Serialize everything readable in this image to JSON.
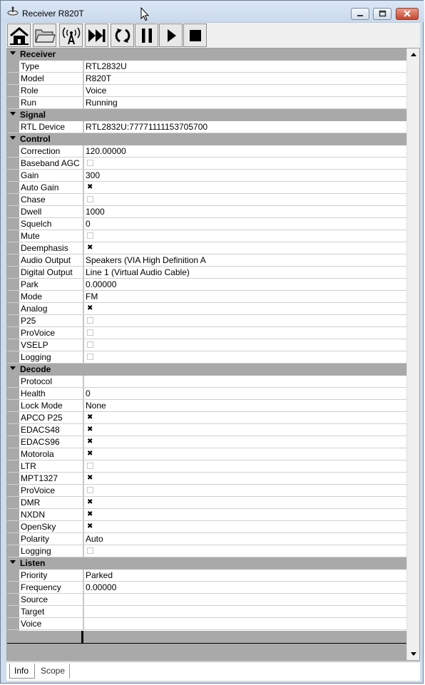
{
  "window": {
    "title": "Receiver R820T"
  },
  "toolbar": {
    "buttons": [
      {
        "name": "home-button",
        "icon": "home-icon"
      },
      {
        "name": "open-button",
        "icon": "folder-icon"
      },
      {
        "name": "antenna-button",
        "icon": "antenna-icon"
      },
      {
        "name": "skip-button",
        "icon": "skip-forward-icon"
      },
      {
        "name": "refresh-button",
        "icon": "refresh-icon"
      },
      {
        "name": "pause-button",
        "icon": "pause-icon"
      },
      {
        "name": "play-button",
        "icon": "play-icon"
      },
      {
        "name": "stop-button",
        "icon": "stop-icon"
      }
    ]
  },
  "grid": {
    "categories": [
      {
        "label": "Receiver",
        "rows": [
          {
            "name": "Type",
            "value": "RTL2832U"
          },
          {
            "name": "Model",
            "value": "R820T"
          },
          {
            "name": "Role",
            "value": "Voice"
          },
          {
            "name": "Run",
            "value": "Running"
          }
        ]
      },
      {
        "label": "Signal",
        "rows": [
          {
            "name": "RTL Device",
            "value": "RTL2832U:77771111153705700"
          }
        ]
      },
      {
        "label": "Control",
        "rows": [
          {
            "name": "Correction",
            "value": "120.00000"
          },
          {
            "name": "Baseband AGC",
            "checkbox": true,
            "checked": false
          },
          {
            "name": "Gain",
            "value": "300"
          },
          {
            "name": "Auto Gain",
            "checkbox": true,
            "checked": true
          },
          {
            "name": "Chase",
            "checkbox": true,
            "checked": false
          },
          {
            "name": "Dwell",
            "value": "1000"
          },
          {
            "name": "Squelch",
            "value": "0"
          },
          {
            "name": "Mute",
            "checkbox": true,
            "checked": false
          },
          {
            "name": "Deemphasis",
            "checkbox": true,
            "checked": true
          },
          {
            "name": "Audio Output",
            "value": "Speakers (VIA High Definition A"
          },
          {
            "name": "Digital Output",
            "value": "Line 1 (Virtual Audio Cable)"
          },
          {
            "name": "Park",
            "value": "0.00000"
          },
          {
            "name": "Mode",
            "value": "FM"
          },
          {
            "name": "Analog",
            "checkbox": true,
            "checked": true
          },
          {
            "name": "P25",
            "checkbox": true,
            "checked": false
          },
          {
            "name": "ProVoice",
            "checkbox": true,
            "checked": false
          },
          {
            "name": "VSELP",
            "checkbox": true,
            "checked": false
          },
          {
            "name": "Logging",
            "checkbox": true,
            "checked": false
          }
        ]
      },
      {
        "label": "Decode",
        "rows": [
          {
            "name": "Protocol",
            "value": ""
          },
          {
            "name": "Health",
            "value": "0"
          },
          {
            "name": "Lock Mode",
            "value": "None"
          },
          {
            "name": "APCO P25",
            "checkbox": true,
            "checked": true
          },
          {
            "name": "EDACS48",
            "checkbox": true,
            "checked": true
          },
          {
            "name": "EDACS96",
            "checkbox": true,
            "checked": true
          },
          {
            "name": "Motorola",
            "checkbox": true,
            "checked": true
          },
          {
            "name": "LTR",
            "checkbox": true,
            "checked": false
          },
          {
            "name": "MPT1327",
            "checkbox": true,
            "checked": true
          },
          {
            "name": "ProVoice",
            "checkbox": true,
            "checked": false
          },
          {
            "name": "DMR",
            "checkbox": true,
            "checked": true
          },
          {
            "name": "NXDN",
            "checkbox": true,
            "checked": true
          },
          {
            "name": "OpenSky",
            "checkbox": true,
            "checked": true
          },
          {
            "name": "Polarity",
            "value": "Auto"
          },
          {
            "name": "Logging",
            "checkbox": true,
            "checked": false
          }
        ]
      },
      {
        "label": "Listen",
        "rows": [
          {
            "name": "Priority",
            "value": "Parked"
          },
          {
            "name": "Frequency",
            "value": "0.00000"
          },
          {
            "name": "Source",
            "value": ""
          },
          {
            "name": "Target",
            "value": ""
          },
          {
            "name": "Voice",
            "value": ""
          }
        ]
      }
    ]
  },
  "tabs": [
    {
      "label": "Info",
      "active": true
    },
    {
      "label": "Scope",
      "active": false
    }
  ],
  "colors": {
    "category_bg": "#a9a9a9",
    "titlebar": "#cfdcec",
    "close_button": "#c4472f"
  }
}
